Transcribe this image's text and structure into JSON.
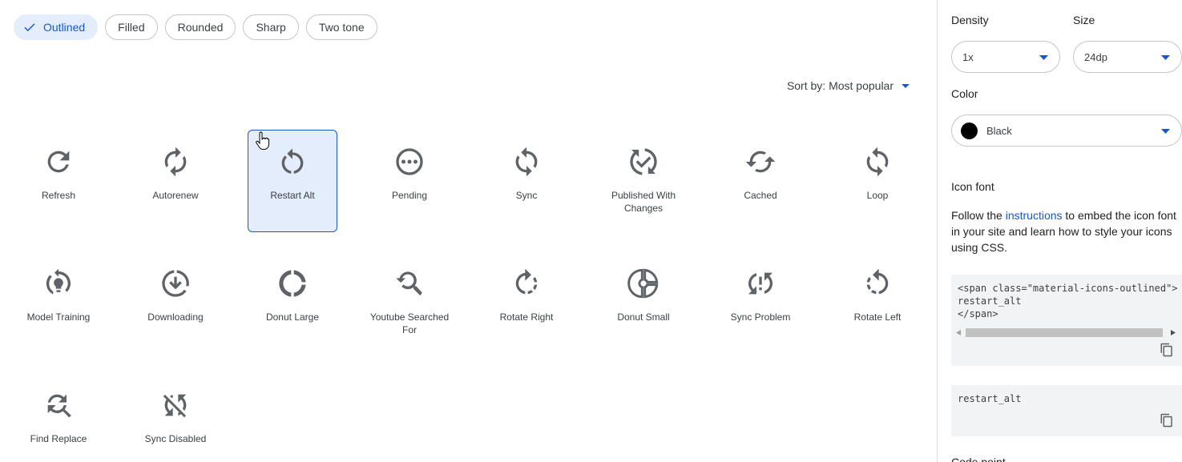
{
  "styles": {
    "chips": [
      {
        "label": "Outlined",
        "active": true
      },
      {
        "label": "Filled",
        "active": false
      },
      {
        "label": "Rounded",
        "active": false
      },
      {
        "label": "Sharp",
        "active": false
      },
      {
        "label": "Two tone",
        "active": false
      }
    ]
  },
  "sort": {
    "label": "Sort by: Most popular"
  },
  "icons": [
    {
      "label": "Refresh",
      "icon": "refresh-icon"
    },
    {
      "label": "Autorenew",
      "icon": "autorenew-icon"
    },
    {
      "label": "Restart Alt",
      "icon": "restart-alt-icon",
      "selected": true
    },
    {
      "label": "Pending",
      "icon": "pending-icon"
    },
    {
      "label": "Sync",
      "icon": "sync-icon"
    },
    {
      "label": "Published With Changes",
      "icon": "published-with-changes-icon"
    },
    {
      "label": "Cached",
      "icon": "cached-icon"
    },
    {
      "label": "Loop",
      "icon": "loop-icon"
    },
    {
      "label": "Model Training",
      "icon": "model-training-icon"
    },
    {
      "label": "Downloading",
      "icon": "downloading-icon"
    },
    {
      "label": "Donut Large",
      "icon": "donut-large-icon"
    },
    {
      "label": "Youtube Searched For",
      "icon": "youtube-searched-for-icon"
    },
    {
      "label": "Rotate Right",
      "icon": "rotate-right-icon"
    },
    {
      "label": "Donut Small",
      "icon": "donut-small-icon"
    },
    {
      "label": "Sync Problem",
      "icon": "sync-problem-icon"
    },
    {
      "label": "Rotate Left",
      "icon": "rotate-left-icon"
    },
    {
      "label": "Find Replace",
      "icon": "find-replace-icon"
    },
    {
      "label": "Sync Disabled",
      "icon": "sync-disabled-icon"
    }
  ],
  "panel": {
    "density": {
      "label": "Density",
      "value": "1x"
    },
    "size": {
      "label": "Size",
      "value": "24dp"
    },
    "color": {
      "label": "Color",
      "value": "Black",
      "swatch": "#000000"
    },
    "icon_font": {
      "heading": "Icon font",
      "text_before": "Follow the ",
      "link": "instructions",
      "text_after": " to embed the icon font in your site and learn how to style your icons using CSS."
    },
    "code_snippet": "<span class=\"material-icons-outlined\">\nrestart_alt\n</span>",
    "ligature": "restart_alt",
    "code_point_heading": "Code point"
  },
  "colors": {
    "accent": "#1a57c7",
    "selected_bg": "#e3edfb",
    "icon": "#5f6368"
  }
}
